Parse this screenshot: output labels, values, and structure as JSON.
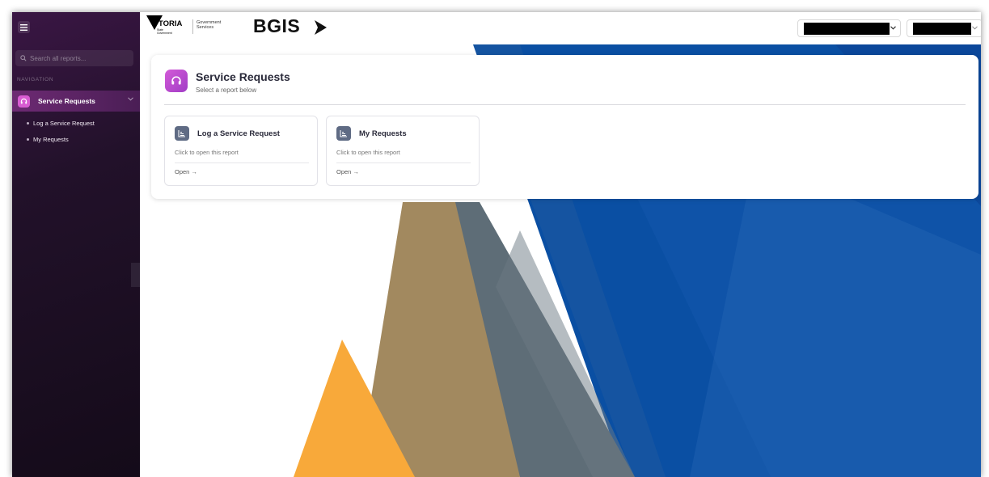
{
  "sidebar": {
    "search_placeholder": "Search all reports...",
    "nav_label": "NAVIGATION",
    "active_item": {
      "label": "Service Requests",
      "icon": "headset-icon"
    },
    "sub_items": [
      {
        "label": "Log a Service Request"
      },
      {
        "label": "My Requests"
      }
    ]
  },
  "header": {
    "logo_main": "VICTORIA",
    "logo_state": "State",
    "logo_gov": "Government",
    "gov_services_line1": "Government",
    "gov_services_line2": "Services",
    "brand": "BGIS"
  },
  "page": {
    "title": "Service Requests",
    "subtitle": "Select a report below",
    "reports": [
      {
        "title": "Log a Service Request",
        "description": "Click to open this report",
        "action": "Open →"
      },
      {
        "title": "My Requests",
        "description": "Click to open this report",
        "action": "Open →"
      }
    ]
  },
  "colors": {
    "sidebar_accent": "#d85cd2",
    "page_icon": "#b048cc",
    "report_icon": "#5f6b84",
    "bg_blue": "#0a4fa3",
    "bg_orange": "#f8a93a",
    "bg_tan": "#a2895f",
    "bg_slate": "#5e6d77"
  }
}
